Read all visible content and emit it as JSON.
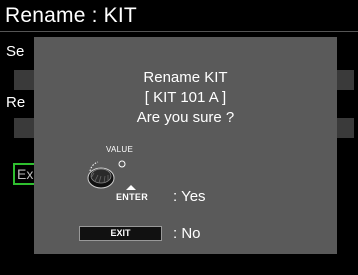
{
  "screen": {
    "title": "Rename : KIT",
    "field1_label": "Se",
    "field2_label": "Re",
    "exec_label": "Ex"
  },
  "dialog": {
    "line1": "Rename KIT",
    "line2": "[ KIT 101 A ]",
    "line3": "Are you sure ?",
    "value_label": "VALUE",
    "enter_label": "ENTER",
    "yes_text": ": Yes",
    "exit_label": "EXIT",
    "no_text": ": No",
    "knob_icon": "value-knob-icon"
  },
  "colors": {
    "background": "#000000",
    "dialog": "#5a5a5a",
    "field": "#3a3a3a",
    "exec_border": "#2fbf2f"
  }
}
